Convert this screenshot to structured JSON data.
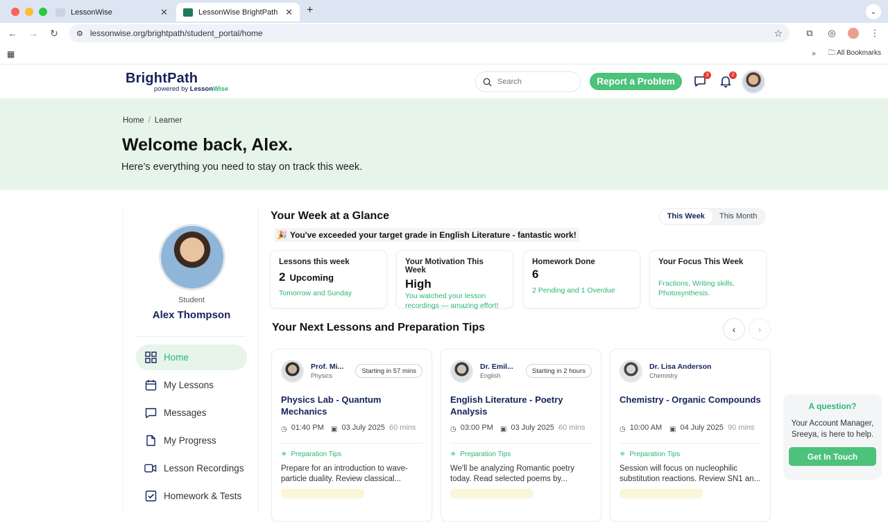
{
  "browser": {
    "tabs": [
      {
        "label": "LessonWise",
        "active": false
      },
      {
        "label": "LessonWise BrightPath",
        "active": true
      }
    ],
    "url": "lessonwise.org/brightpath/student_portal/home",
    "bookmarks_label": "All Bookmarks"
  },
  "header": {
    "brand": "BrightPath",
    "powered_by": "powered by",
    "powered_lesson": "Lesson",
    "powered_wise": "Wise",
    "search_placeholder": "Search",
    "report_label": "Report a Problem",
    "messages_count": "3",
    "notifications_count": "2"
  },
  "hero": {
    "breadcrumb": [
      "Home",
      "Learner"
    ],
    "title": "Welcome back, Alex.",
    "subtitle": "Here’s everything you need to stay on track this week."
  },
  "profile": {
    "role": "Student",
    "name": "Alex Thompson"
  },
  "menu": [
    {
      "label": "Home",
      "icon": "grid-icon",
      "active": true
    },
    {
      "label": "My Lessons",
      "icon": "calendar-icon",
      "active": false
    },
    {
      "label": "Messages",
      "icon": "chat-icon",
      "active": false
    },
    {
      "label": "My Progress",
      "icon": "document-icon",
      "active": false
    },
    {
      "label": "Lesson Recordings",
      "icon": "video-icon",
      "active": false
    },
    {
      "label": "Homework & Tests",
      "icon": "checkbox-icon",
      "active": false
    }
  ],
  "week": {
    "title": "Your Week at a Glance",
    "toggle": [
      "This Week",
      "This Month"
    ],
    "banner": "You've exceeded your target grade in English Literature - fantastic work!",
    "stats": [
      {
        "title": "Lessons this week",
        "value": "2",
        "value_label": "Upcoming",
        "note": "Tomorrow and Sunday"
      },
      {
        "title": "Your Motivation This Week",
        "value": "High",
        "value_label": "",
        "note": "You watched your lesson recordings — amazing effort!"
      },
      {
        "title": "Homework Done",
        "value": "6",
        "value_label": "",
        "note": "2 Pending and 1 Overdue"
      },
      {
        "title": "Your Focus This Week",
        "value": "",
        "value_label": "",
        "note": "Fractions, Writing skills, Photosynthesis."
      }
    ]
  },
  "next": {
    "title": "Your Next Lessons and Preparation Tips",
    "lessons": [
      {
        "teacher": "Prof. Mi...",
        "subject": "Physics",
        "starting": "Starting in 57 mins",
        "title": "Physics Lab - Quantum Mechanics",
        "time": "01:40 PM",
        "date": "03 July 2025",
        "duration": "60 mins",
        "prep_label": "Preparation Tips",
        "prep": "Prepare for an introduction to wave-particle duality. Review classical..."
      },
      {
        "teacher": "Dr. Emil...",
        "subject": "English",
        "starting": "Starting in 2 hours",
        "title": "English Literature - Poetry Analysis",
        "time": "03:00 PM",
        "date": "03 July 2025",
        "duration": "60 mins",
        "prep_label": "Preparation Tips",
        "prep": "We'll be analyzing Romantic poetry today. Read selected poems by..."
      },
      {
        "teacher": "Dr. Lisa Anderson",
        "subject": "Chemistry",
        "starting": "",
        "title": "Chemistry - Organic Compounds",
        "time": "10:00 AM",
        "date": "04 July 2025",
        "duration": "90 mins",
        "prep_label": "Preparation Tips",
        "prep": "Session will focus on nucleophilic substitution reactions. Review SN1 an..."
      }
    ]
  },
  "help": {
    "title": "A question?",
    "text": "Your Account Manager, Sreeya, is here to help.",
    "button": "Get In Touch"
  },
  "colors": {
    "accent": "#4cc27a",
    "brand": "#14235a",
    "hero_bg": "#e6f4ea"
  }
}
